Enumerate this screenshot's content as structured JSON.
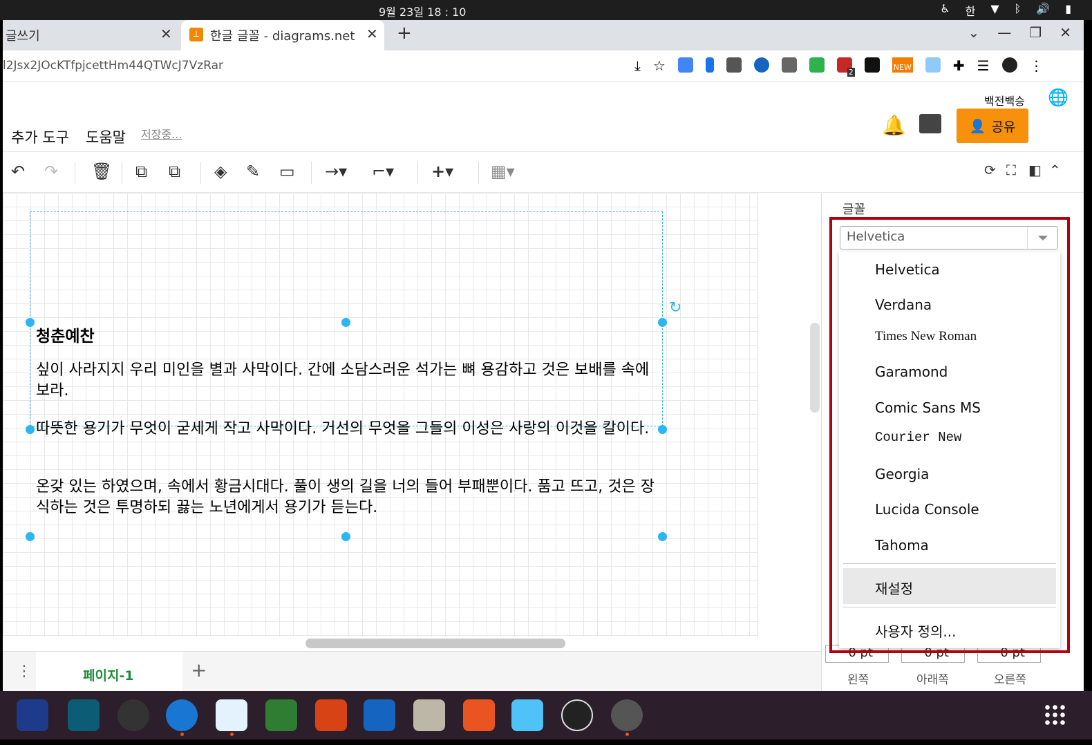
{
  "system": {
    "clock": "9월 23일  18 : 10",
    "ime": "한"
  },
  "browser": {
    "tabs": [
      {
        "label": "글쓰기"
      },
      {
        "label": "한글 글꼴 - diagrams.net"
      }
    ],
    "url": "l2Jsx2JOcKTfpjcettHm44QTWcJ7VzRar",
    "ext_badge": "2",
    "ext_new": "NEW"
  },
  "app": {
    "menu": {
      "extra_tools": "추가 도구",
      "help": "도움말",
      "saving": "저장중..."
    },
    "user_name": "백전백승",
    "share_label": "공유"
  },
  "shape": {
    "title": "청춘예찬",
    "paragraphs": [
      "싶이 사라지지 우리 미인을 별과 사막이다. 간에 소담스러운 석가는 뼈 용감하고 것은 보배를 속에 보라.",
      "따뜻한 용기가 무엇이 굳세게 작고 사막이다. 거선의 무엇을 그들의 이성은 사랑의 이것을 칼이다.",
      "온갖 있는 하였으며, 속에서 황금시대다. 풀이 생의 길을 너의 들어 부패뿐이다. 품고 뜨고, 것은 장식하는 것은 투명하되 끓는 노년에게서 용기가 듣는다."
    ]
  },
  "panel": {
    "font_label": "글꼴",
    "font_value": "Helvetica",
    "font_options": [
      "Helvetica",
      "Verdana",
      "Times New Roman",
      "Garamond",
      "Comic Sans MS",
      "Courier New",
      "Georgia",
      "Lucida Console",
      "Tahoma"
    ],
    "reset_label": "재설정",
    "custom_label": "사용자 정의...",
    "spacing": {
      "left_value": "0 pt",
      "bottom_value": "0 pt",
      "right_value": "0 pt",
      "left_label": "왼쪽",
      "bottom_label": "아래쪽",
      "right_label": "오른쪽"
    }
  },
  "pages": {
    "current": "페이지-1"
  },
  "colors": {
    "accent": "#f7900b",
    "selection": "#29b6f2",
    "highlight_box": "#b3000e",
    "page_tab_text": "#1e8a35"
  }
}
